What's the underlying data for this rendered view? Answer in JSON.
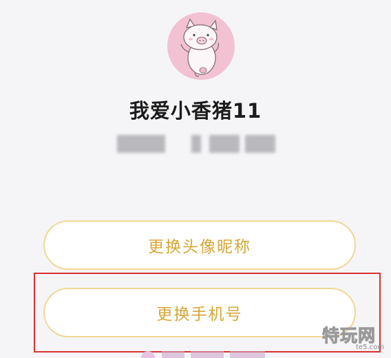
{
  "profile": {
    "nickname": "我爱小香猪11"
  },
  "actions": {
    "change_avatar_nickname": "更换头像昵称",
    "change_phone": "更换手机号"
  },
  "watermark": {
    "text": "特玩网",
    "domain": "te5.com"
  },
  "colors": {
    "background": "#f5f5f8",
    "avatar_bg": "#f2c2d2",
    "button_border": "#f1d794",
    "button_text": "#d6a634",
    "highlight_border": "#d8302f"
  }
}
